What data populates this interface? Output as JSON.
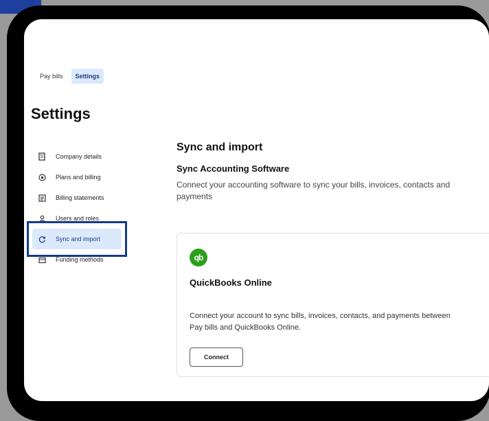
{
  "tabs": [
    {
      "label": "Pay bills"
    },
    {
      "label": "Settings"
    }
  ],
  "page": {
    "title": "Settings"
  },
  "sidebar": {
    "items": [
      {
        "label": "Company details",
        "icon": "building-icon"
      },
      {
        "label": "Plans and billing",
        "icon": "target-icon"
      },
      {
        "label": "Billing statements",
        "icon": "statement-icon"
      },
      {
        "label": "Users and roles",
        "icon": "user-icon"
      },
      {
        "label": "Sync and import",
        "icon": "sync-icon",
        "active": true
      },
      {
        "label": "Funding methods",
        "icon": "wallet-icon"
      }
    ]
  },
  "main": {
    "section_title": "Sync and import",
    "subsection_title": "Sync Accounting Software",
    "description": "Connect your accounting software to sync your bills, invoices, contacts and payments",
    "integration": {
      "logo_text": "qb",
      "name": "QuickBooks Online",
      "description": "Connect your account to sync bills, invoices, contacts, and payments between Pay bills and QuickBooks Online.",
      "button_label": "Connect"
    }
  },
  "colors": {
    "accent": "#1b3d86",
    "active_bg": "#dbe9fb",
    "highlight_border": "#123a8f",
    "quickbooks_green": "#2ca01c"
  }
}
